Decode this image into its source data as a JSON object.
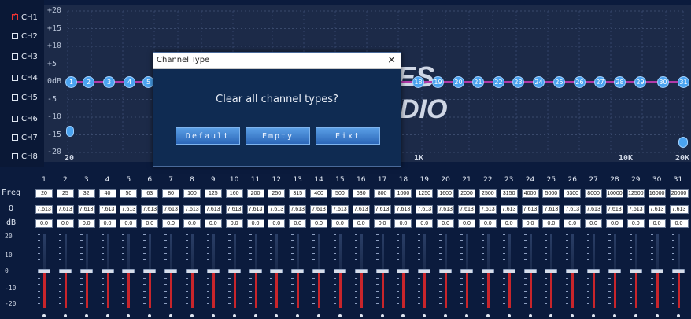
{
  "channels": [
    "CH1",
    "CH2",
    "CH3",
    "CH4",
    "CH5",
    "CH6",
    "CH7",
    "CH8"
  ],
  "channel_checked": [
    true,
    false,
    false,
    false,
    false,
    false,
    false,
    false
  ],
  "graph": {
    "y_labels": [
      "+20",
      "+15",
      "+10",
      "+5",
      "0dB",
      "-5",
      "-10",
      "-15",
      "-20"
    ],
    "x_labels": [
      "20",
      "1K",
      "10K",
      "20K"
    ],
    "watermark": [
      "ES",
      "DIO"
    ],
    "curve_color": "#b13aa8",
    "node_color": "#4aa3f0"
  },
  "table": {
    "row_labels": [
      "Freq",
      "Q",
      "dB"
    ],
    "numbers": [
      "1",
      "2",
      "3",
      "4",
      "5",
      "6",
      "7",
      "8",
      "9",
      "10",
      "11",
      "12",
      "13",
      "14",
      "15",
      "16",
      "17",
      "18",
      "19",
      "20",
      "21",
      "22",
      "23",
      "24",
      "25",
      "26",
      "27",
      "28",
      "29",
      "30",
      "31"
    ],
    "freq": [
      "20",
      "25",
      "32",
      "40",
      "50",
      "63",
      "80",
      "100",
      "125",
      "160",
      "200",
      "250",
      "315",
      "400",
      "500",
      "630",
      "800",
      "1000",
      "1250",
      "1600",
      "2000",
      "2500",
      "3150",
      "4000",
      "5000",
      "6300",
      "8000",
      "10000",
      "12500",
      "16000",
      "20000"
    ],
    "q": [
      "7.613",
      "7.613",
      "7.613",
      "7.613",
      "7.613",
      "7.613",
      "7.613",
      "7.613",
      "7.613",
      "7.613",
      "7.613",
      "7.613",
      "7.613",
      "7.613",
      "7.613",
      "7.613",
      "7.613",
      "7.613",
      "7.613",
      "7.613",
      "7.613",
      "7.613",
      "7.613",
      "7.613",
      "7.613",
      "7.613",
      "7.613",
      "7.613",
      "7.613",
      "7.613",
      "7.613"
    ],
    "db": [
      "0.0",
      "0.0",
      "0.0",
      "0.0",
      "0.0",
      "0.0",
      "0.0",
      "0.0",
      "0.0",
      "0.0",
      "0.0",
      "0.0",
      "0.0",
      "0.0",
      "0.0",
      "0.0",
      "0.0",
      "0.0",
      "0.0",
      "0.0",
      "0.0",
      "0.0",
      "0.0",
      "0.0",
      "0.0",
      "0.0",
      "0.0",
      "0.0",
      "0.0",
      "0.0",
      "0.0"
    ],
    "slider_labels": [
      "20",
      "10",
      "0",
      "-10",
      "-20"
    ],
    "slider_gain_db": 0
  },
  "dialog": {
    "title": "Channel Type",
    "close": "×",
    "message": "Clear all channel types?",
    "buttons": [
      "Default",
      "Empty",
      "Eixt"
    ]
  },
  "visible_nodes": {
    "left": [
      "1",
      "2",
      "3",
      "4",
      "5"
    ],
    "right": [
      "18",
      "19",
      "20",
      "21",
      "22",
      "23",
      "24",
      "25",
      "26",
      "27",
      "28",
      "29",
      "30",
      "31"
    ]
  }
}
